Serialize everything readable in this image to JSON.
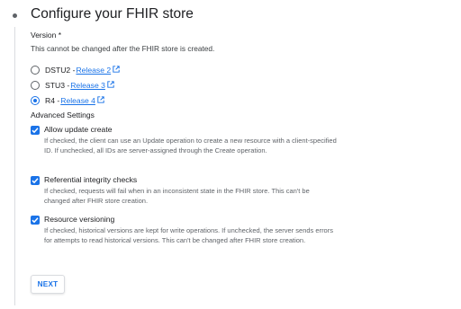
{
  "title": "Configure your FHIR store",
  "version": {
    "label": "Version *",
    "note": "This cannot be changed after the FHIR store is created.",
    "options": [
      {
        "name": "DSTU2",
        "link": "Release 2",
        "selected": false
      },
      {
        "name": "STU3",
        "link": "Release 3",
        "selected": false
      },
      {
        "name": "R4",
        "link": "Release 4",
        "selected": true
      }
    ]
  },
  "advanced": {
    "label": "Advanced Settings",
    "items": [
      {
        "label": "Allow update create",
        "help": "If checked, the client can use an Update operation to create a new resource with a client-specified ID. If unchecked, all IDs are server-assigned through the Create operation.",
        "checked": true
      },
      {
        "label": "Referential integrity checks",
        "help": "If checked, requests will fail when in an inconsistent state in the FHIR store. This can't be changed after FHIR store creation.",
        "checked": true
      },
      {
        "label": "Resource versioning",
        "help": "If checked, historical versions are kept for write operations. If unchecked, the server sends errors for attempts to read historical versions. This can't be changed after FHIR store creation.",
        "checked": true
      }
    ]
  },
  "next_label": "NEXT",
  "colors": {
    "accent": "#1a73e8",
    "text": "#202124",
    "muted": "#5f6368"
  }
}
